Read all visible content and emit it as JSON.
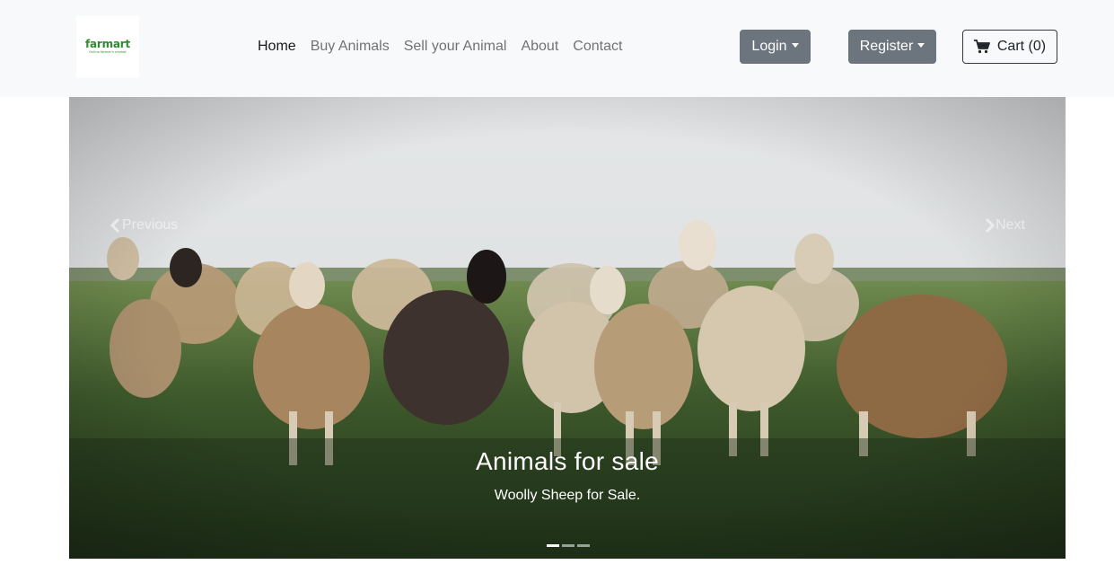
{
  "brand": {
    "logo_text": "farmart",
    "logo_tagline": "Online farmer's market"
  },
  "nav": {
    "links": [
      {
        "label": "Home",
        "active": true
      },
      {
        "label": "Buy Animals",
        "active": false
      },
      {
        "label": "Sell your Animal",
        "active": false
      },
      {
        "label": "About",
        "active": false
      },
      {
        "label": "Contact",
        "active": false
      }
    ]
  },
  "actions": {
    "login_label": "Login",
    "register_label": "Register",
    "cart_label": "Cart (0)"
  },
  "carousel": {
    "prev_label": "Previous",
    "next_label": "Next",
    "slide": {
      "title": "Animals for sale",
      "text": "Woolly Sheep for Sale."
    },
    "indicators": 3,
    "active_index": 0
  },
  "colors": {
    "navbar_bg": "#f8f9fa",
    "button_secondary": "#6c757d",
    "brand_green": "#2e8b2e"
  }
}
